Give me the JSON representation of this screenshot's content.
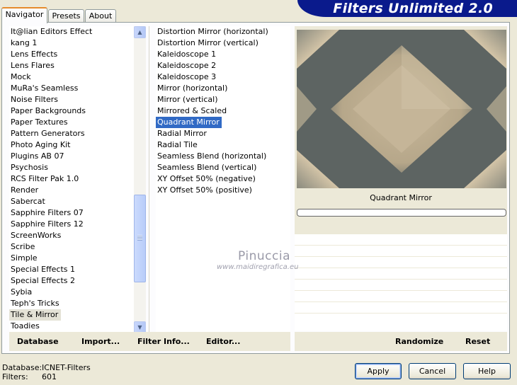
{
  "header": {
    "title": "Filters Unlimited 2.0"
  },
  "tabs": [
    {
      "label": "Navigator",
      "active": true
    },
    {
      "label": "Presets",
      "active": false
    },
    {
      "label": "About",
      "active": false
    }
  ],
  "categories": {
    "items": [
      "It@lian Editors Effect",
      "kang 1",
      "Lens Effects",
      "Lens Flares",
      "Mock",
      "MuRa's Seamless",
      "Noise Filters",
      "Paper Backgrounds",
      "Paper Textures",
      "Pattern Generators",
      "Photo Aging Kit",
      "Plugins AB 07",
      "Psychosis",
      "RCS Filter Pak 1.0",
      "Render",
      "Sabercat",
      "Sapphire Filters 07",
      "Sapphire Filters 12",
      "ScreenWorks",
      "Scribe",
      "Simple",
      "Special Effects 1",
      "Special Effects 2",
      "Sybia",
      "Teph's Tricks",
      "Tile & Mirror",
      "Toadies"
    ],
    "selected": "Tile & Mirror"
  },
  "filters": {
    "items": [
      "Distortion Mirror (horizontal)",
      "Distortion Mirror (vertical)",
      "Kaleidoscope 1",
      "Kaleidoscope 2",
      "Kaleidoscope 3",
      "Mirror (horizontal)",
      "Mirror (vertical)",
      "Mirrored & Scaled",
      "Quadrant Mirror",
      "Radial Mirror",
      "Radial Tile",
      "Seamless Blend (horizontal)",
      "Seamless Blend (vertical)",
      "XY Offset 50% (negative)",
      "XY Offset 50% (positive)"
    ],
    "selected": "Quadrant Mirror"
  },
  "preview": {
    "filter_name": "Quadrant Mirror",
    "colors": {
      "dark": "#5d6462",
      "light": "#c9b89a"
    }
  },
  "commands": {
    "database": "Database",
    "import": "Import...",
    "filter_info": "Filter Info...",
    "editor": "Editor...",
    "randomize": "Randomize",
    "reset": "Reset"
  },
  "watermark": {
    "name": "Pinuccia",
    "url": "www.maidiregrafica.eu"
  },
  "footer": {
    "database_label": "Database:",
    "database_value": "ICNET-Filters",
    "filters_label": "Filters:",
    "filters_value": "601"
  },
  "buttons": {
    "apply": "Apply",
    "cancel": "Cancel",
    "help": "Help"
  },
  "colors": {
    "banner": "#0a1a8c",
    "selection": "#316ac5",
    "window_bg": "#ece9d8"
  }
}
